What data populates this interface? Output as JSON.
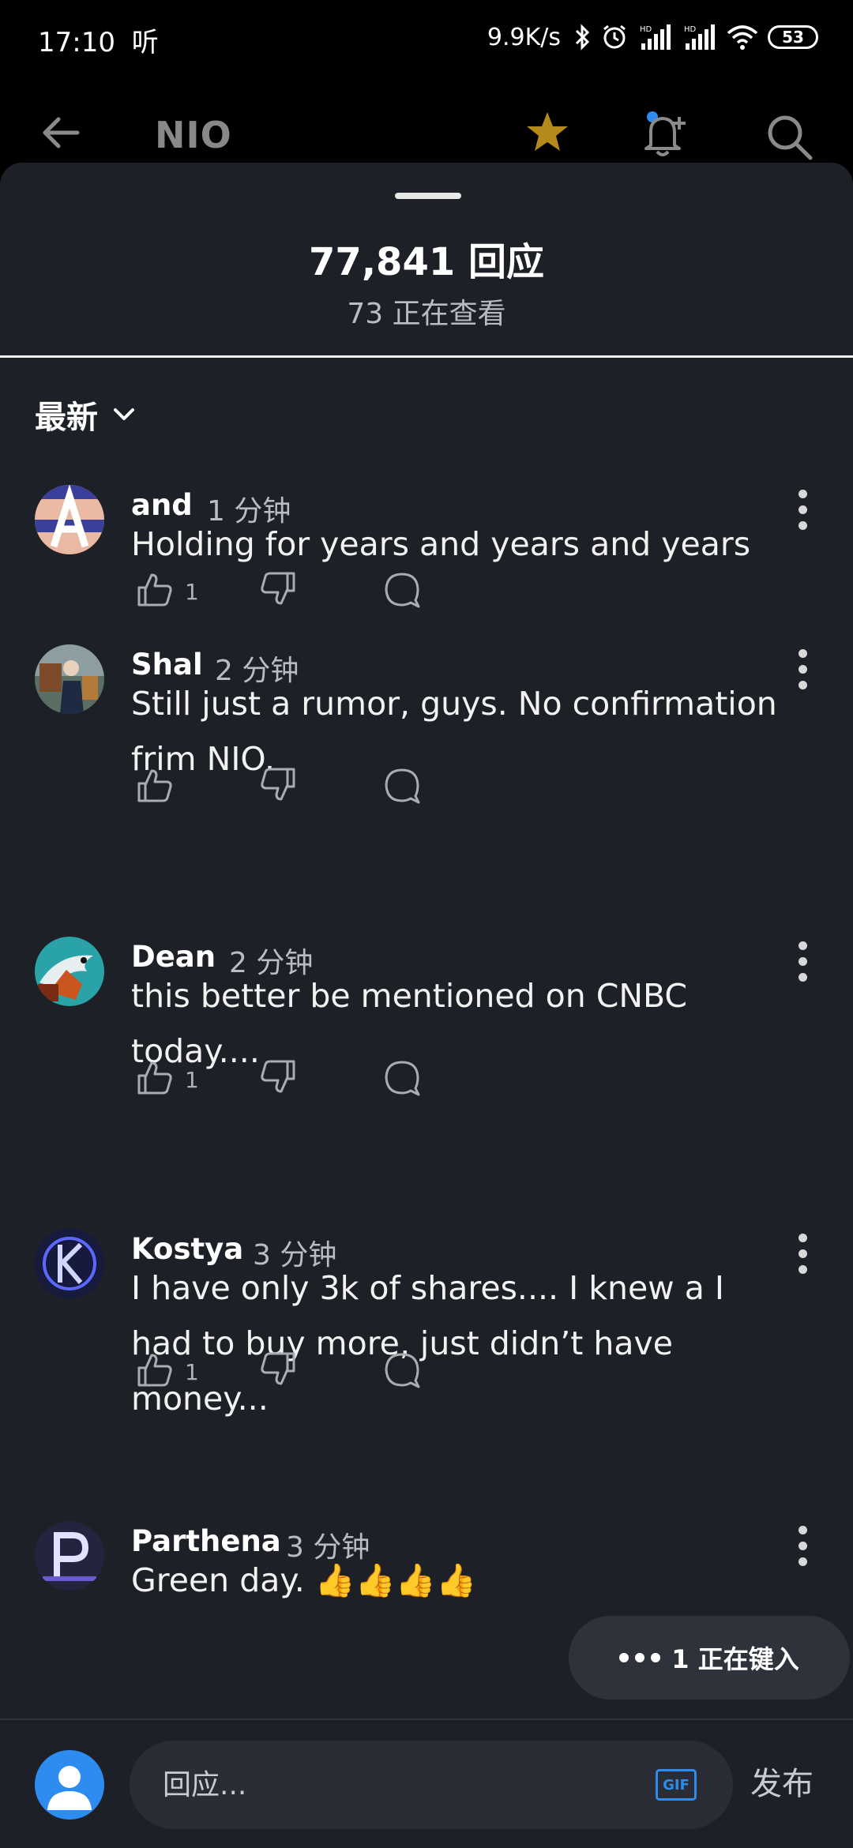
{
  "status_bar": {
    "time": "17:10",
    "carrier_glyph": "听",
    "net_speed": "9.9K/s",
    "battery": "53"
  },
  "app_bar": {
    "ticker": "NIO"
  },
  "sheet": {
    "title": "77,841 回应",
    "viewing": "73 正在查看",
    "sort_label": "最新"
  },
  "comments": [
    {
      "user": "and",
      "time": "1 分钟",
      "text": "Holding for years and years and years",
      "likes": "1"
    },
    {
      "user": "Shal",
      "time": "2 分钟",
      "text": "Still just a rumor, guys. No confirmation frim NIO.",
      "likes": ""
    },
    {
      "user": "Dean",
      "time": "2 分钟",
      "text": "this better be mentioned on CNBC today....",
      "likes": "1"
    },
    {
      "user": "Kostya",
      "time": "3 分钟",
      "text": "I have only 3k of shares.... I knew a I had to buy more, just didn’t have money...",
      "likes": "1"
    },
    {
      "user": "Parthena",
      "time": "3 分钟",
      "text": "Green day. 👍👍👍👍",
      "likes": ""
    }
  ],
  "typing": {
    "label": "1 正在键入"
  },
  "composer": {
    "placeholder": "回应...",
    "gif_label": "GIF",
    "post_label": "发布"
  },
  "colors": {
    "sheet_bg": "#1d2027",
    "accent_blue": "#2d8cf0",
    "star": "#b48a1c",
    "muted_text": "#b9bcc3"
  }
}
